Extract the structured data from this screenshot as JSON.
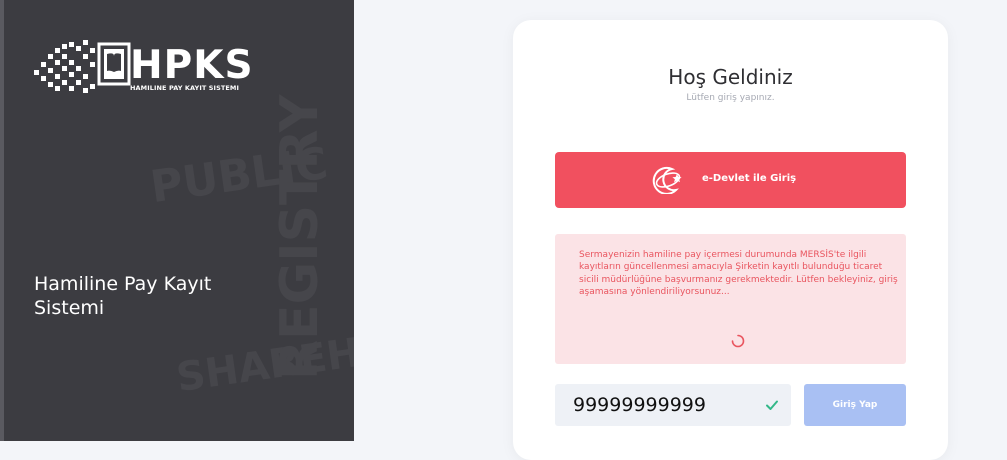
{
  "brand": {
    "logo_text": "HPKS",
    "logo_subtitle": "HAMILINE PAY KAYIT SISTEMI",
    "tagline": "Hamiline Pay Kayıt Sistemi",
    "watermarks": [
      "PUBLIC",
      "REGISTRY",
      "SHAREHOLDERS"
    ]
  },
  "login": {
    "welcome": "Hoş Geldiniz",
    "subtitle": "Lütfen giriş yapınız.",
    "edevlet_label": "e-Devlet ile Giriş",
    "notice": "Sermayenizin hamiline pay içermesi durumunda MERSİS'te ilgili kayıtların güncellenmesi amacıyla Şirketin kayıtlı bulunduğu ticaret sicili müdürlüğüne başvurmanız gerekmektedir. Lütfen bekleyiniz, giriş aşamasına yönlendiriliyorsunuz...",
    "id_value": "99999999999",
    "login_button": "Giriş Yap"
  },
  "colors": {
    "left_panel": "#3c3c41",
    "accent_red": "#f1505f",
    "notice_bg": "#fbe3e6",
    "login_button": "#a9c0f3",
    "check_green": "#33b889"
  },
  "icons": {
    "logo": "book-grid-logo-icon",
    "edevlet": "edevlet-crescent-star-icon",
    "spinner": "loading-spinner-icon",
    "check": "check-icon"
  }
}
